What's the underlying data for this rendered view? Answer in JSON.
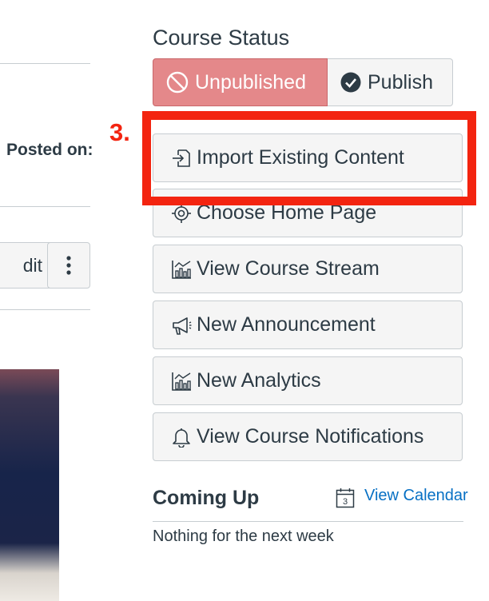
{
  "left_panel": {
    "posted_on_label": "Posted on:",
    "edit_button_label": "dit",
    "more_button_icon": "vertical-ellipsis-icon"
  },
  "course_status": {
    "title": "Course Status",
    "unpublished_label": "Unpublished",
    "unpublished_icon": "prohibited-icon",
    "publish_label": "Publish",
    "publish_icon": "check-circle-icon"
  },
  "annotation": {
    "step_label": "3.",
    "color": "#f32410"
  },
  "actions": [
    {
      "label": "Import Existing Content",
      "icon": "import-icon"
    },
    {
      "label": "Choose Home Page",
      "icon": "target-icon"
    },
    {
      "label": "View Course Stream",
      "icon": "analytics-icon"
    },
    {
      "label": "New Announcement",
      "icon": "megaphone-icon"
    },
    {
      "label": "New Analytics",
      "icon": "analytics-icon"
    },
    {
      "label": "View Course Notifications",
      "icon": "bell-icon"
    }
  ],
  "coming_up": {
    "title": "Coming Up",
    "calendar_icon_day": "3",
    "view_calendar_label": "View Calendar",
    "empty_message": "Nothing for the next week"
  },
  "colors": {
    "unpublished_bg": "#e4888a",
    "link": "#0770c4",
    "text": "#2d3b45",
    "button_bg": "#f5f5f5"
  }
}
